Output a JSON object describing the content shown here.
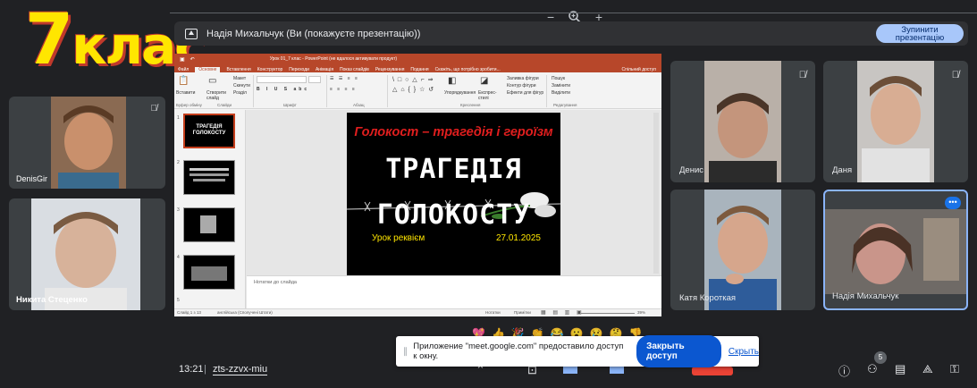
{
  "overlay": {
    "class_number": "7",
    "class_word": "клас"
  },
  "zoom": {
    "minus": "−",
    "plus": "+"
  },
  "banner": {
    "text": "Надія Михальчук (Ви (покажуєте презентацію))",
    "stop_label": "Зупинити презентацію"
  },
  "left_tiles": [
    {
      "name": "DenisGir",
      "muted": true
    },
    {
      "name": "Никита Стеценко",
      "muted": false
    }
  ],
  "ppt": {
    "window_title": "Урок 01_7 клас - PowerPoint (не вдалося активувати продукт)",
    "tabs": [
      "Файл",
      "Основне",
      "Вставлення",
      "Конструктор",
      "Переходи",
      "Анімація",
      "Показ слайдів",
      "Рецензування",
      "Подання",
      "Скажіть, що потрібно зробити..."
    ],
    "share_label": "Спільний доступ",
    "ribbon": {
      "paste": "Вставити",
      "new_slide": "Створити слайд",
      "layout": "Макет",
      "reset": "Скинути",
      "section": "Розділ",
      "arrange": "Упорядкування",
      "quick_styles": "Експрес-стилі",
      "fill": "Заливка фігури",
      "outline": "Контур фігури",
      "effects": "Ефекти для фігур",
      "find": "Пошук",
      "replace": "Замінити",
      "select": "Виділити",
      "groups": [
        "Буфер обміну",
        "Слайди",
        "Шрифт",
        "Абзац",
        "Креслення",
        "Редагування"
      ]
    },
    "thumb_numbers": [
      "1",
      "2",
      "3",
      "4",
      "5"
    ],
    "slide": {
      "title": "Голокост – трагедія і героїзм",
      "big1": "ТРАГЕДІЯ",
      "big2": "ГОЛОКОСТУ",
      "sub_left": "Урок реквієм",
      "sub_right": "27.01.2025"
    },
    "notes_placeholder": "Нотатки до слайда",
    "status_left": "Слайд 1 з 13",
    "status_lang": "англійська (Сполучені Штати)",
    "status_notes": "Нотатки",
    "status_comments": "Примітки",
    "zoom_level": "39%"
  },
  "right_tiles": [
    {
      "name": "Денис",
      "muted": true
    },
    {
      "name": "Даня",
      "muted": true
    },
    {
      "name": "Катя Короткая",
      "muted": false
    },
    {
      "name": "Надія Михальчук",
      "muted": false,
      "active": true
    }
  ],
  "reactions": [
    "💖",
    "👍",
    "🎉",
    "👏",
    "😂",
    "😮",
    "😢",
    "🤔",
    "👎"
  ],
  "bottom": {
    "time": "13:21",
    "separator": "|",
    "meeting_code": "zts-zzvx-miu",
    "people_count": "5"
  },
  "share_dialog": {
    "message": "Приложение \"meet.google.com\" предоставило доступ к окну.",
    "grant_label": "Закрыть доступ",
    "hide_label": "Скрыть"
  },
  "colors": {
    "meet_bg": "#202124",
    "accent": "#a8c7fa",
    "ppt_brand": "#b7472a",
    "slide_red": "#e01e1e",
    "slide_yellow": "#ffe600",
    "class_yellow": "#ffe600"
  }
}
